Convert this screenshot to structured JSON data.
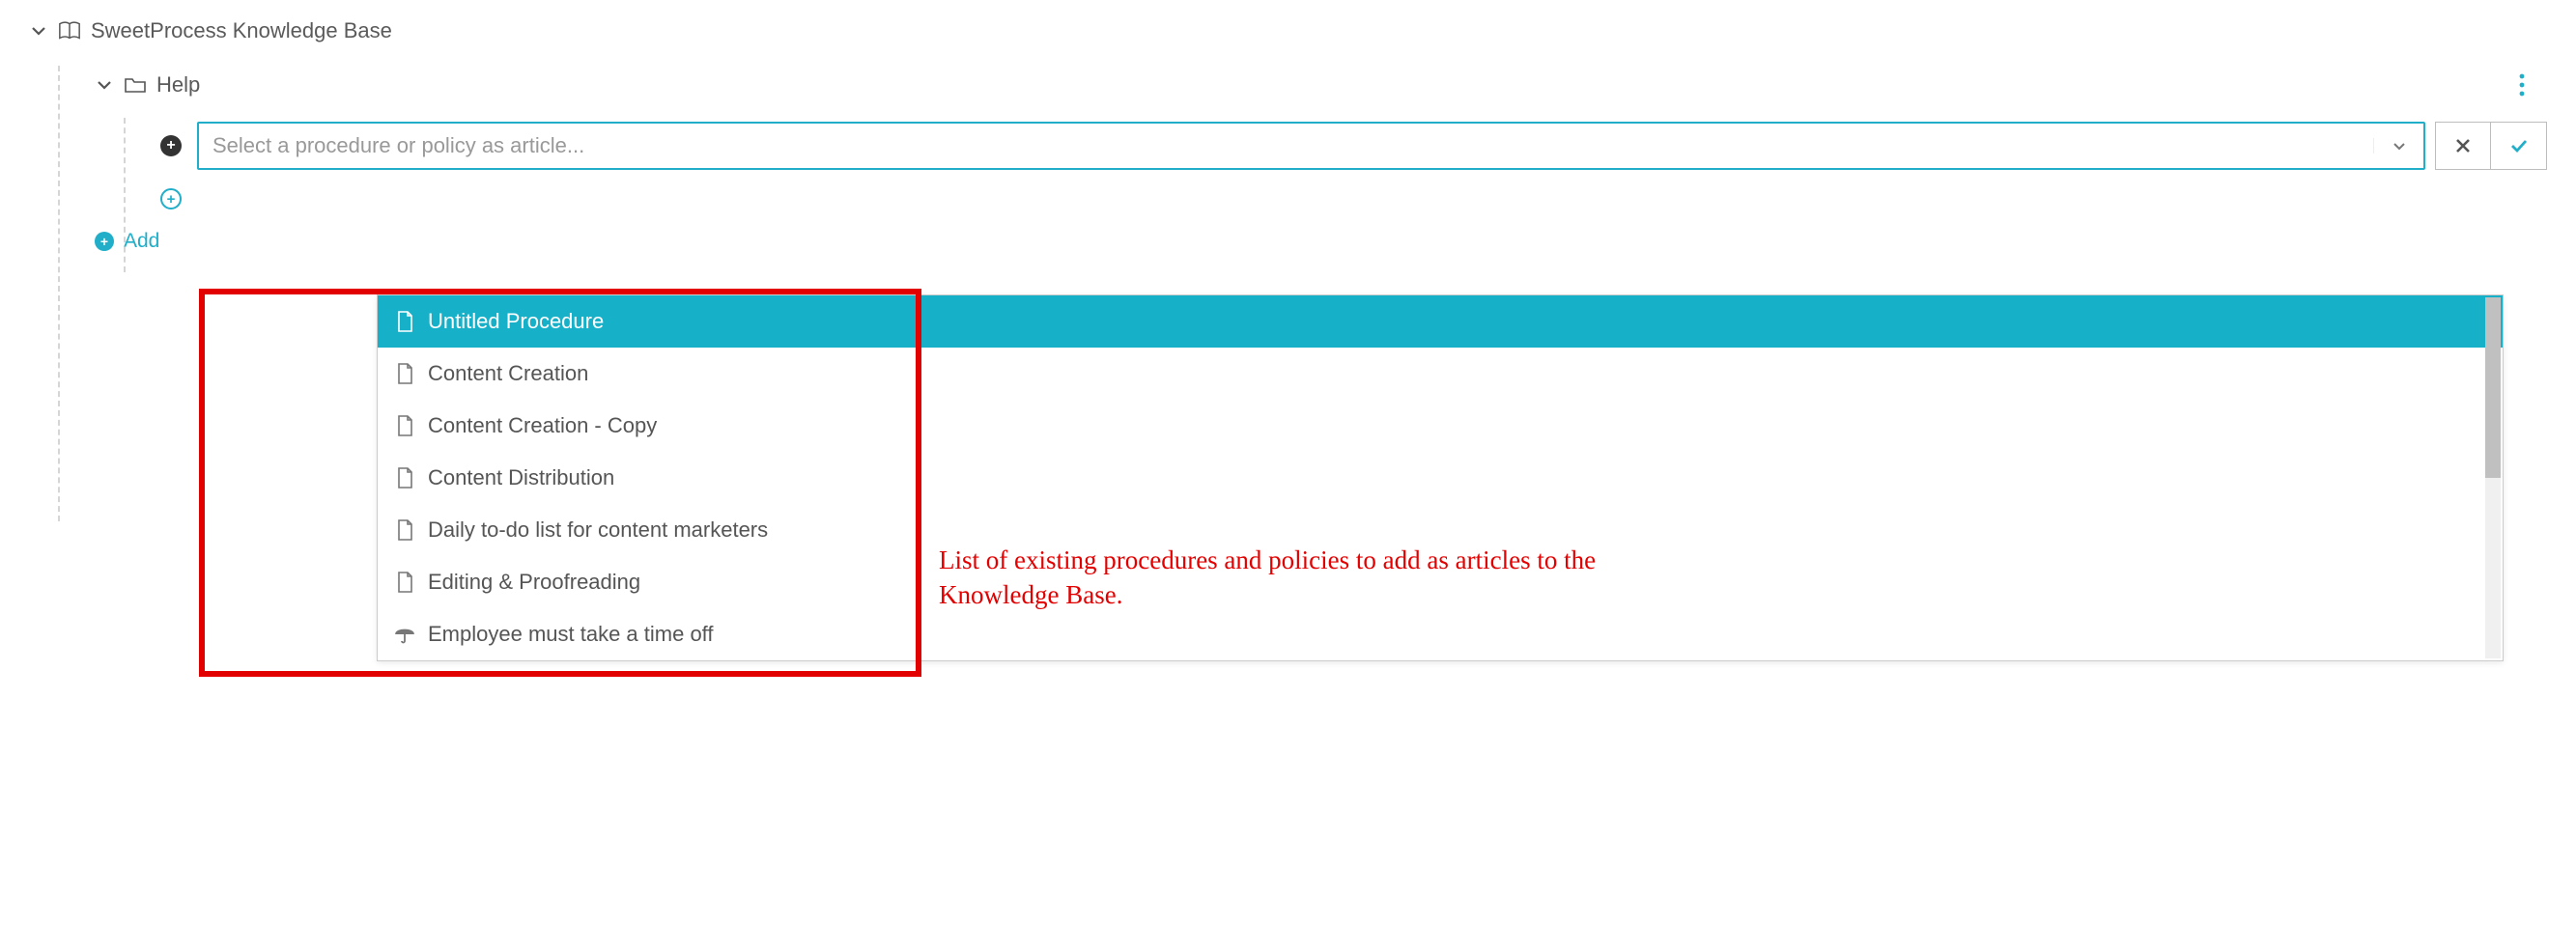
{
  "tree": {
    "root": {
      "label": "SweetProcess Knowledge Base"
    },
    "help": {
      "label": "Help"
    },
    "add_category_label": "Add"
  },
  "select": {
    "placeholder": "Select a procedure or policy as article..."
  },
  "dropdown": [
    {
      "label": "Untitled Procedure",
      "icon": "doc",
      "selected": true
    },
    {
      "label": "Content Creation",
      "icon": "doc",
      "selected": false
    },
    {
      "label": "Content Creation - Copy",
      "icon": "doc",
      "selected": false
    },
    {
      "label": "Content Distribution",
      "icon": "doc",
      "selected": false
    },
    {
      "label": "Daily to-do list for content marketers",
      "icon": "doc",
      "selected": false
    },
    {
      "label": "Editing & Proofreading",
      "icon": "doc",
      "selected": false
    },
    {
      "label": "Employee must take a time off",
      "icon": "umbrella",
      "selected": false
    }
  ],
  "annotation": {
    "text": "List of existing procedures and policies to add as articles to the Knowledge Base."
  }
}
